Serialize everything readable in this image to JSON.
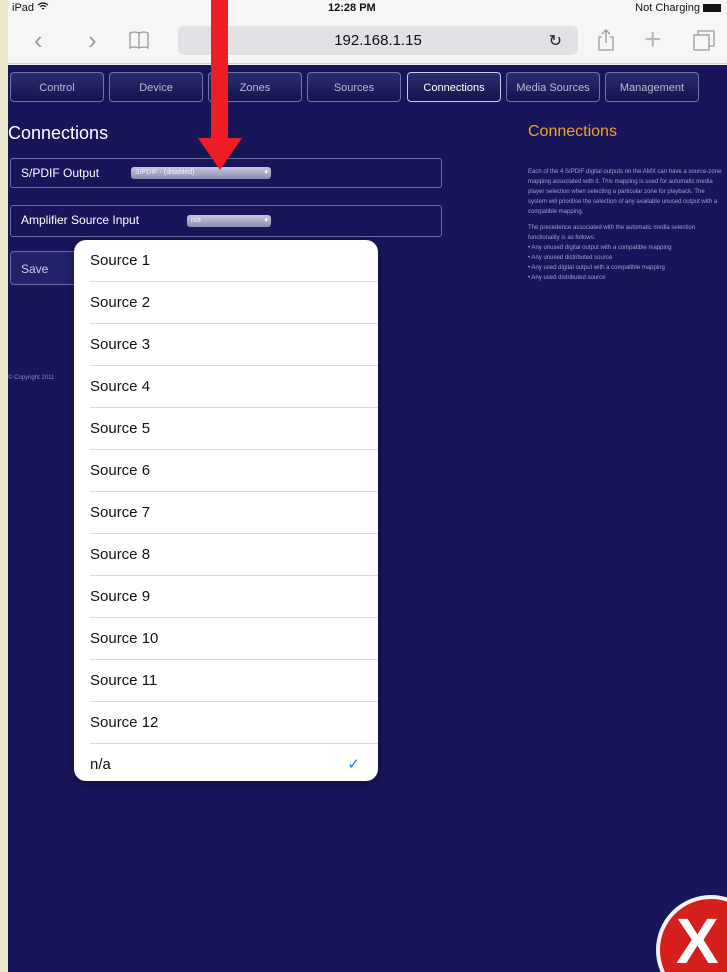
{
  "status_bar": {
    "device": "iPad",
    "wifi_icon": "wifi-icon",
    "time": "12:28 PM",
    "battery_text": "Not Charging"
  },
  "browser": {
    "url": "192.168.1.15"
  },
  "nav_tabs": [
    "Control",
    "Device",
    "Zones",
    "Sources",
    "Connections",
    "Media Sources",
    "Management"
  ],
  "active_tab": "Connections",
  "page": {
    "title": "Connections",
    "spdif_label": "S/PDIF Output",
    "spdif_value": "S/PDIF - (disabled)",
    "amp_label": "Amplifier Source Input",
    "amp_value": "n/a",
    "save_button": "Save Changes",
    "copyright": "© Copyright 2011"
  },
  "help": {
    "title": "Connections",
    "p1": "Each of the 4 S/PDIF digital outputs on the AMX can have a source-zone mapping associated with it. This mapping is used for automatic media player selection when selecting a particular zone for playback. The system will prioritise the selection of any available unused output with a compatible mapping.",
    "p2": "The precedence associated with the automatic media selection functionality is as follows:",
    "bullets": [
      "• Any unused digital output with a compatible mapping",
      "• Any unused distributed source",
      "• Any used digital output with a compatible mapping",
      "• Any used distributed source"
    ]
  },
  "dropdown": {
    "options": [
      "Source 1",
      "Source 2",
      "Source 3",
      "Source 4",
      "Source 5",
      "Source 6",
      "Source 7",
      "Source 8",
      "Source 9",
      "Source 10",
      "Source 11",
      "Source 12",
      "n/a"
    ],
    "selected": "n/a",
    "check_glyph": "✓"
  },
  "colors": {
    "page_bg": "#19155a",
    "accent": "#f2a121",
    "arrow": "#ee1e24",
    "check": "#1a7cf5"
  }
}
